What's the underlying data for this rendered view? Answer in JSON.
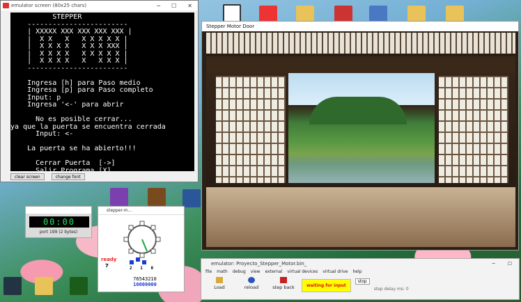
{
  "terminal_window": {
    "title": "emulator screen (80x25 chars)",
    "lines": [
      "          STEPPER",
      "    ------------------------",
      "    | XXXXX XXX XXX XXX XXX |",
      "    |  X X   X   X X X X X |",
      "    |  X X X X   X X X XXX |",
      "    |  X X X X   X X X X X |",
      "    |  X X X X   X   X X X |",
      "    ------------------------",
      "",
      "    Ingresa [h] para Paso medio",
      "    Ingresa [p] para Paso completo",
      "    Input: p",
      "    Ingresa '<-' para abrir",
      "",
      "      No es posible cerrar...",
      "ya que la puerta se encuentra cerrada",
      "      Input: <-",
      "",
      "    La puerta se ha abierto!!!",
      "",
      "      Cerrar Puerta  [->]",
      "      Salir Programa [X]",
      "      Input:"
    ],
    "clear_label": "clear screen",
    "font_label": "change font"
  },
  "stepper_window": {
    "title": "Stepper Motor Door"
  },
  "clock": {
    "display": "00:00",
    "port_label": "port 199 (2 bytes)"
  },
  "motor": {
    "title": "stepper-m...",
    "status": "ready",
    "status_num": "7",
    "bit_labels": "2 1 0",
    "binary_header": "76543210",
    "binary_value": "10000000"
  },
  "emulator": {
    "title": "emulator: Proyecto_Stepper_Motor.bin_",
    "menu": [
      "file",
      "math",
      "debug",
      "view",
      "external",
      "virtual devices",
      "virtual drive",
      "help"
    ],
    "tools": [
      "Load",
      "reload",
      "step back"
    ],
    "status": "waiting for input",
    "stop_label": "stop",
    "step_delay": "step delay ms: 0"
  },
  "colors": {
    "lcd": "#27e06a",
    "status_yellow": "#ffff00",
    "status_red": "#dd1111"
  }
}
